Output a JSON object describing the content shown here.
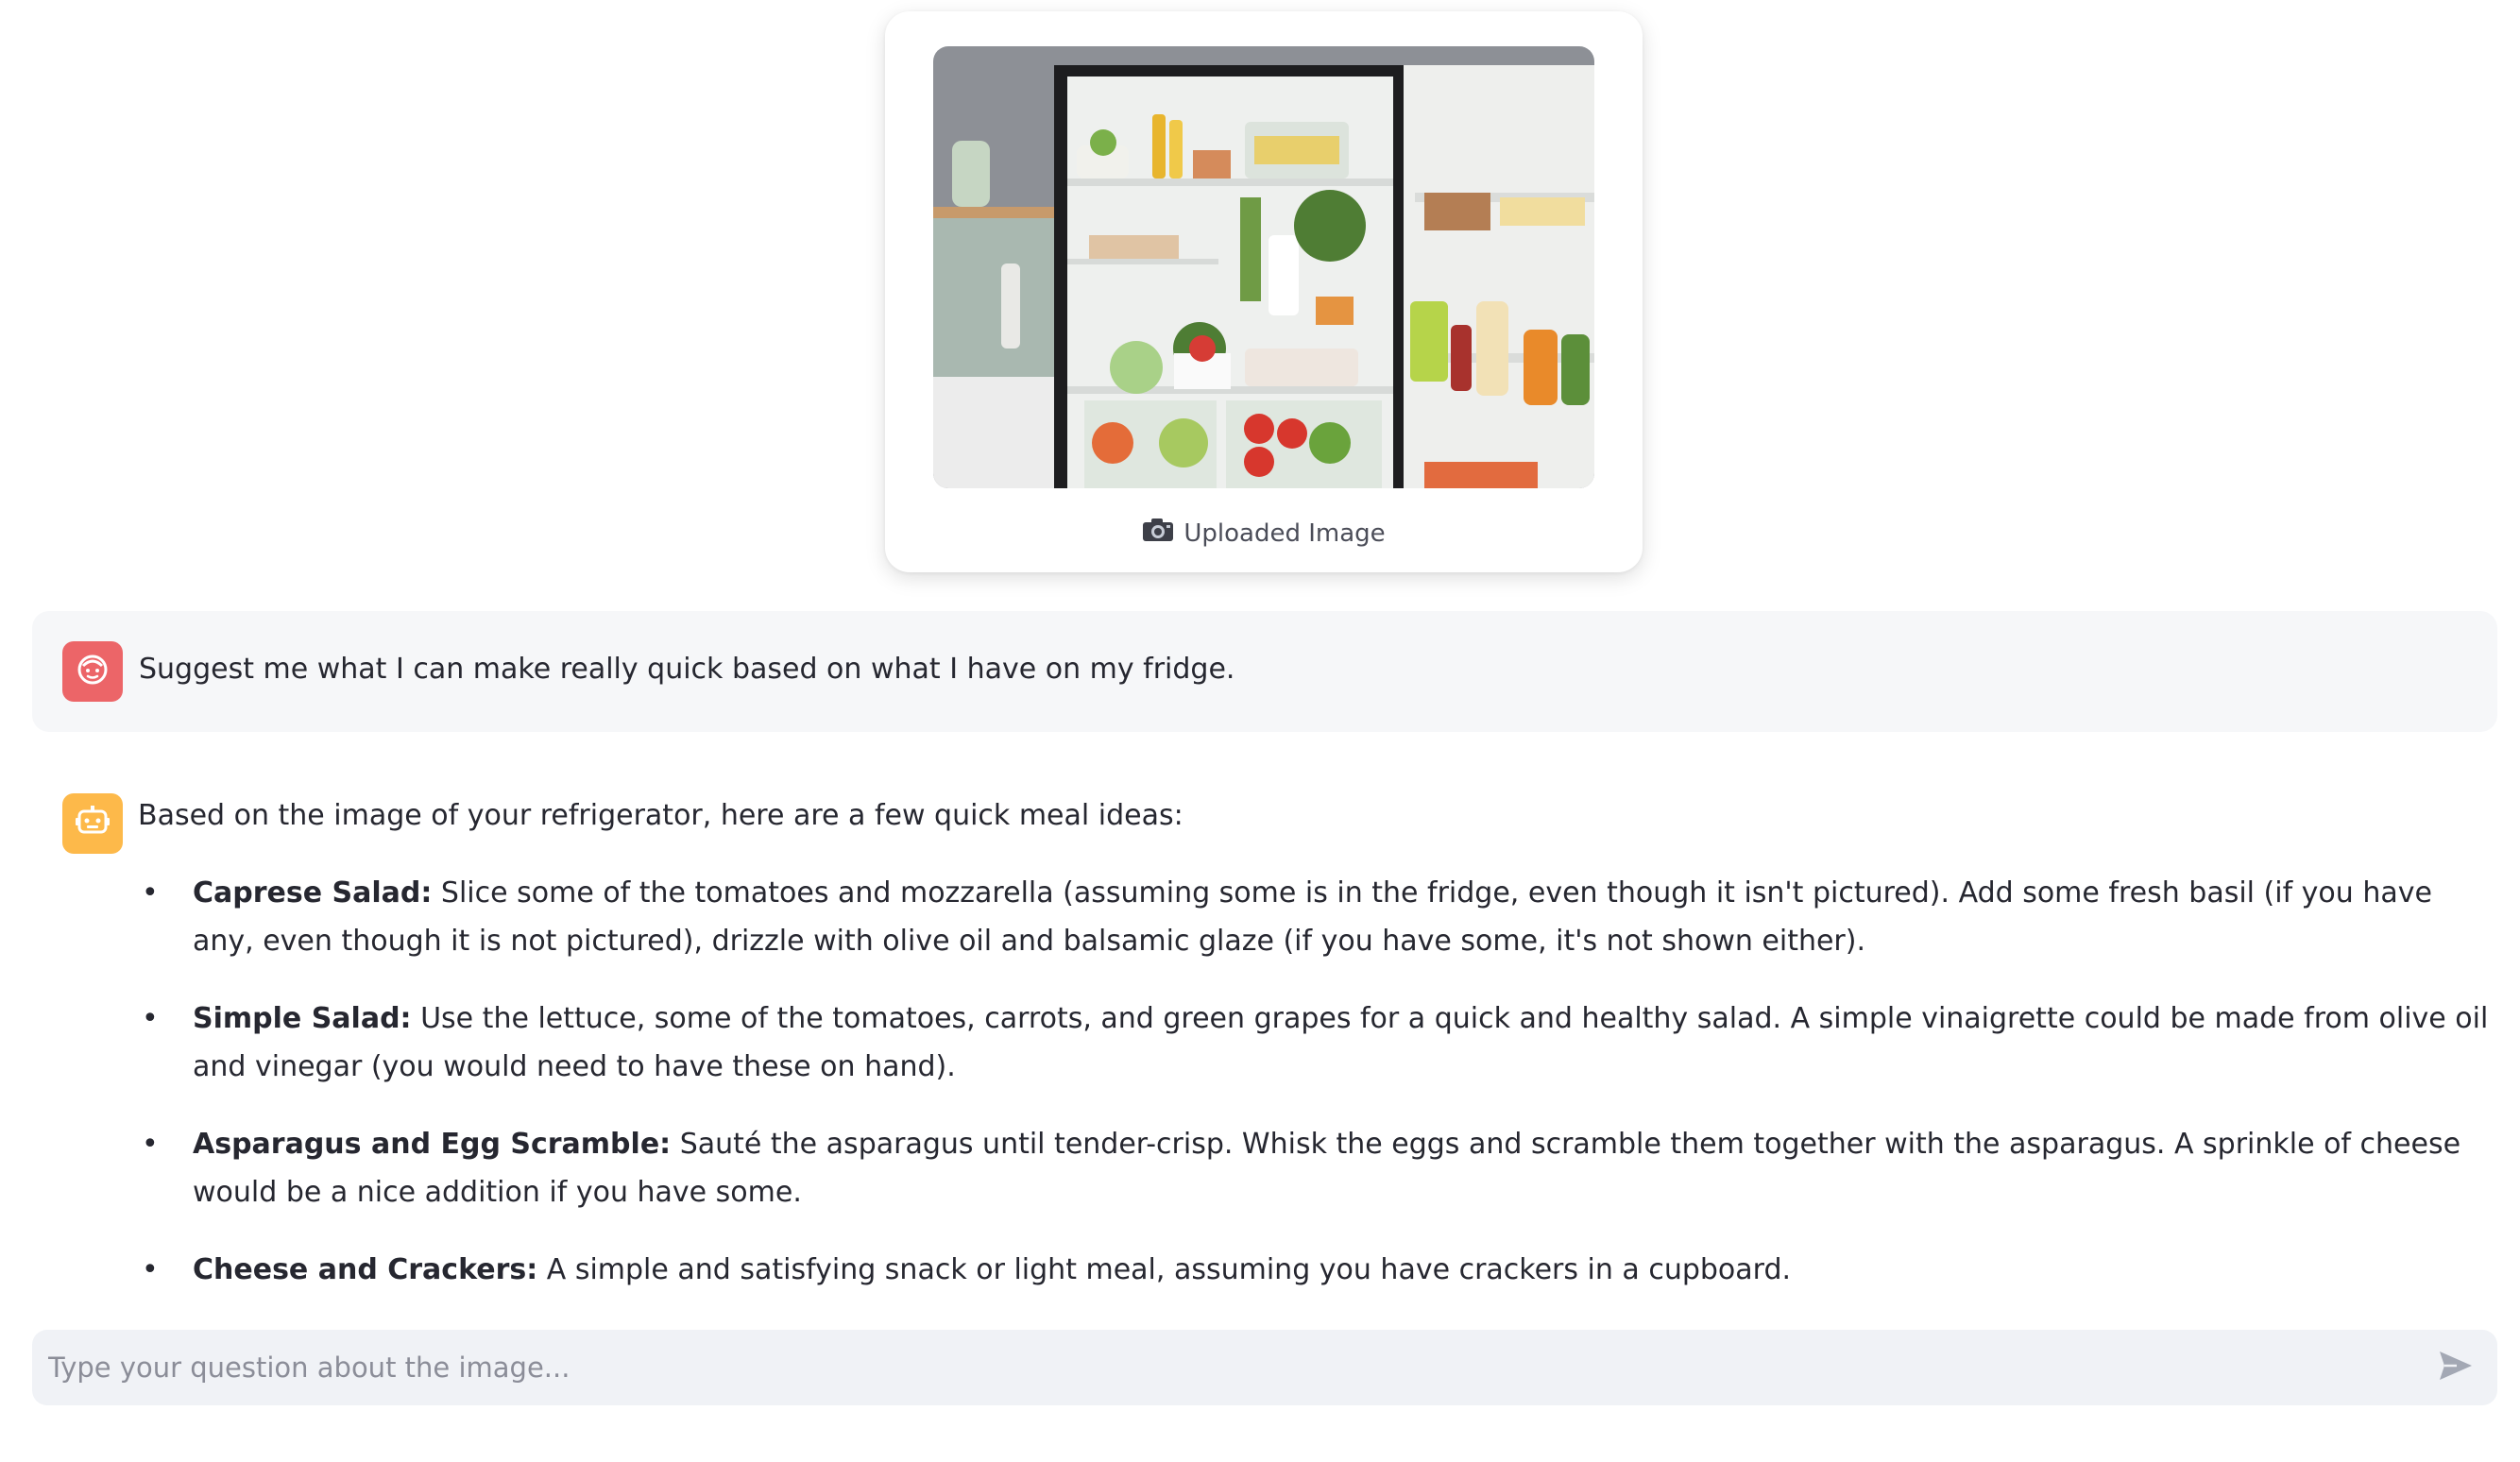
{
  "uploaded_image": {
    "caption_icon": "camera-icon",
    "caption": "Uploaded Image"
  },
  "conversation": {
    "user_message": {
      "avatar_icon": "user-face-icon",
      "avatar_color": "#ec6568",
      "text": "Suggest me what I can make really quick based on what I have on my fridge."
    },
    "assistant_message": {
      "avatar_icon": "robot-icon",
      "avatar_color": "#fdb94a",
      "intro": "Based on the image of your refrigerator, here are a few quick meal ideas:",
      "ideas": [
        {
          "title": "Caprese Salad:",
          "text": " Slice some of the tomatoes and mozzarella (assuming some is in the fridge, even though it isn't pictured). Add some fresh basil (if you have any, even though it is not pictured), drizzle with olive oil and balsamic glaze (if you have some, it's not shown either)."
        },
        {
          "title": "Simple Salad:",
          "text": " Use the lettuce, some of the tomatoes, carrots, and green grapes for a quick and healthy salad. A simple vinaigrette could be made from olive oil and vinegar (you would need to have these on hand)."
        },
        {
          "title": "Asparagus and Egg Scramble:",
          "text": " Sauté the asparagus until tender-crisp. Whisk the eggs and scramble them together with the asparagus. A sprinkle of cheese would be a nice addition if you have some."
        },
        {
          "title": "Cheese and Crackers:",
          "text": " A simple and satisfying snack or light meal, assuming you have crackers in a cupboard."
        }
      ]
    }
  },
  "chat_input": {
    "placeholder": "Type your question about the image...",
    "value": "",
    "send_icon": "send-icon"
  }
}
